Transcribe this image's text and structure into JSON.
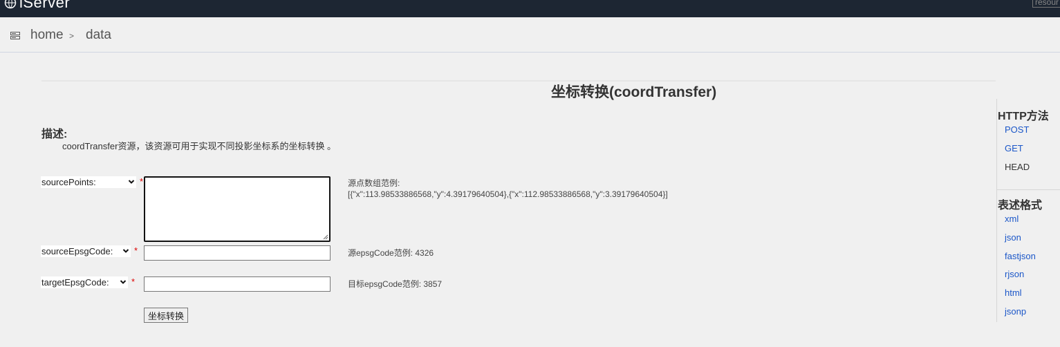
{
  "header": {
    "logo_text": "iServer",
    "search_placeholder": "resour"
  },
  "breadcrumb": {
    "home": "home",
    "separator": ">",
    "current": "data"
  },
  "page": {
    "title": "坐标转换(coordTransfer)",
    "description_heading": "描述:",
    "description": "coordTransfer资源，该资源可用于实现不同投影坐标系的坐标转换 。"
  },
  "form": {
    "source_points": {
      "select_label": "sourcePoints:",
      "required_mark": "*",
      "value": "",
      "hint_label": "源点数组范例:",
      "hint_example": "[{\"x\":113.98533886568,\"y\":4.39179640504},{\"x\":112.98533886568,\"y\":3.39179640504}]"
    },
    "source_epsg": {
      "select_label": "sourceEpsgCode:",
      "required_mark": "*",
      "value": "",
      "hint": "源epsgCode范例: 4326"
    },
    "target_epsg": {
      "select_label": "targetEpsgCode:",
      "required_mark": "*",
      "value": "",
      "hint": "目标epsgCode范例: 3857"
    },
    "submit_label": "坐标转换"
  },
  "sidebar": {
    "http_heading": "HTTP方法",
    "http_methods": [
      {
        "label": "POST",
        "link": true
      },
      {
        "label": "GET",
        "link": true
      },
      {
        "label": "HEAD",
        "link": false
      }
    ],
    "format_heading": "表述格式",
    "formats": [
      "xml",
      "json",
      "fastjson",
      "rjson",
      "html",
      "jsonp"
    ]
  },
  "colors": {
    "topbar": "#1d2633",
    "link": "#1a56c8",
    "required": "#dd0000",
    "background": "#f0f0f0"
  }
}
